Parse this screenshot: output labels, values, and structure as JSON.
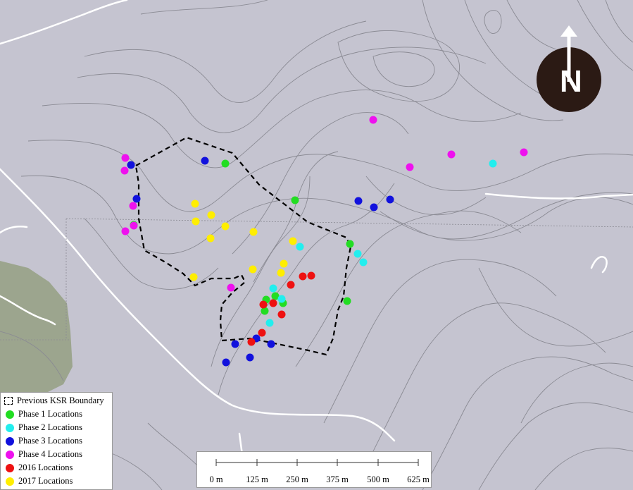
{
  "legend": {
    "items": [
      {
        "label": "Previous KSR Boundary",
        "type": "boundary"
      },
      {
        "label": "Phase 1 Locations",
        "color": "#22dd22"
      },
      {
        "label": "Phase 2 Locations",
        "color": "#22eeee"
      },
      {
        "label": "Phase 3 Locations",
        "color": "#1111dd"
      },
      {
        "label": "Phase 4 Locations",
        "color": "#ee11ee"
      },
      {
        "label": "2016 Locations",
        "color": "#ee1111"
      },
      {
        "label": "2017 Locations",
        "color": "#ffee00"
      }
    ]
  },
  "scale_bar": {
    "labels": [
      "0 m",
      "125 m",
      "250 m",
      "375 m",
      "500 m",
      "625 m"
    ]
  },
  "north_arrow": {
    "letter": "N",
    "color": "#2b1a14"
  },
  "map": {
    "background": "#c5c4d0",
    "forest_color": "#9ca58e",
    "contour_color": "#8a8a93",
    "road_color": "#ffffff"
  }
}
